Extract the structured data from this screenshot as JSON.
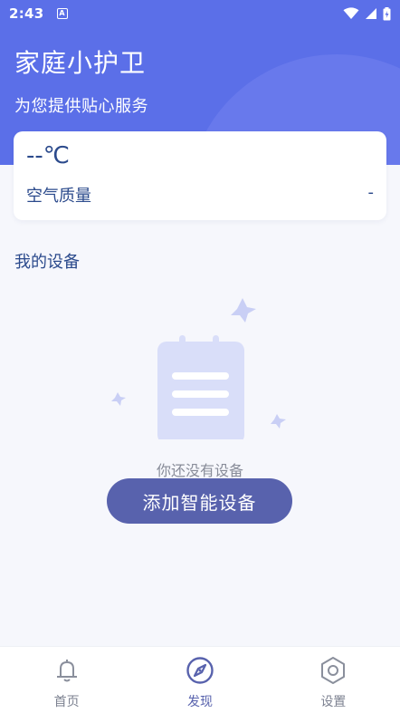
{
  "status_bar": {
    "time": "2:43",
    "notification_badge": "A"
  },
  "header": {
    "title": "家庭小护卫",
    "subtitle": "为您提供贴心服务"
  },
  "weather": {
    "temperature": "--℃",
    "air_quality_label": "空气质量",
    "air_quality_value": "-"
  },
  "devices": {
    "section_title": "我的设备",
    "empty_text": "你还没有设备",
    "add_button_label": "添加智能设备"
  },
  "bottom_nav": {
    "items": [
      {
        "label": "首页",
        "icon": "bell-icon",
        "active": false
      },
      {
        "label": "发现",
        "icon": "compass-icon",
        "active": true
      },
      {
        "label": "设置",
        "icon": "hexagon-gear-icon",
        "active": false
      }
    ]
  },
  "colors": {
    "header_bg": "#5b6fe8",
    "accent": "#5862ad",
    "page_bg": "#f6f7fc",
    "text_blue": "#2b4a8c",
    "illustration": "#d9def9"
  }
}
